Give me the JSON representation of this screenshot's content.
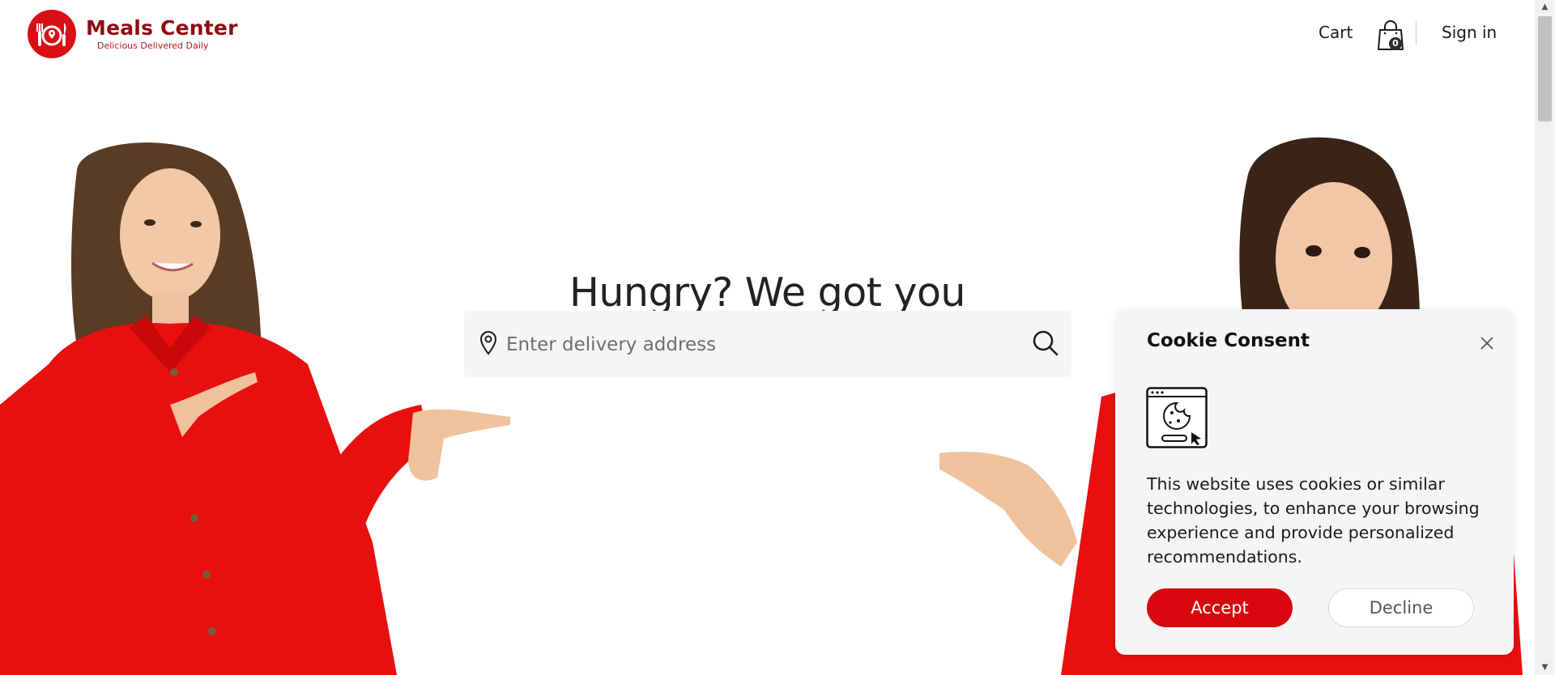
{
  "header": {
    "logo_title": "Meals Center",
    "logo_tagline": "Delicious Delivered Daily",
    "cart_label": "Cart",
    "cart_count": "0",
    "signin_label": "Sign in"
  },
  "hero": {
    "title": "Hungry? We got you",
    "search_placeholder": "Enter delivery address"
  },
  "cookie": {
    "title": "Cookie Consent",
    "body": "This website uses cookies or similar technologies, to enhance your browsing experience and provide personalized recommendations.",
    "accept_label": "Accept",
    "decline_label": "Decline"
  },
  "colors": {
    "brand": "#d90f16",
    "brand_dark": "#8f0b10",
    "accept_button": "#d8080e",
    "search_bg": "#f4f5f6",
    "modal_bg": "#f5f5f6"
  },
  "icons": [
    "logo-icon",
    "shopping-bag-icon",
    "location-pin-icon",
    "search-icon",
    "close-icon",
    "cookie-browser-icon"
  ]
}
